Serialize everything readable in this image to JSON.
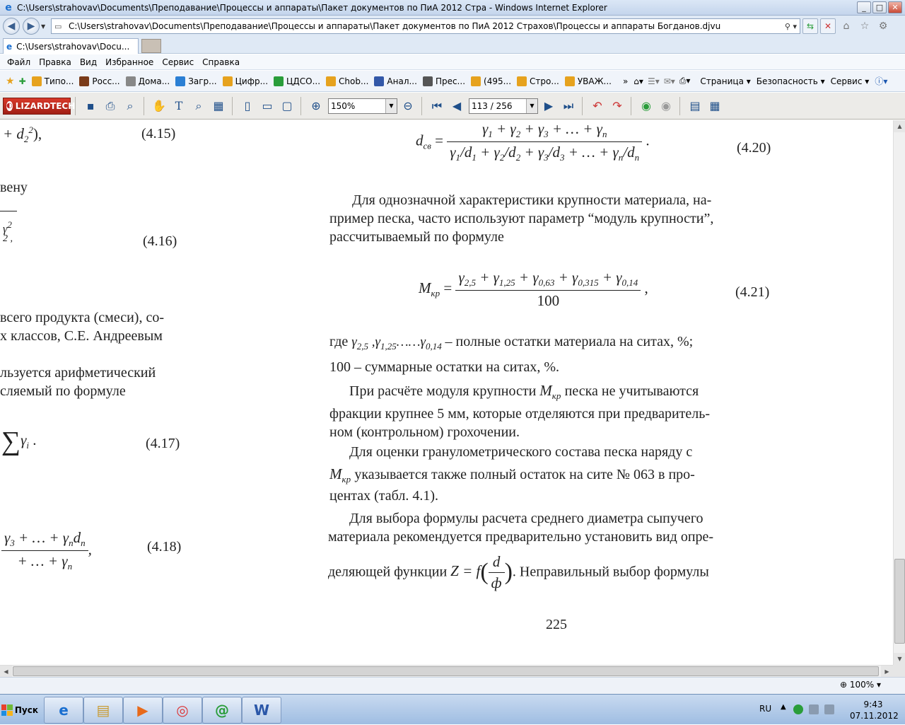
{
  "window": {
    "title": "C:\\Users\\strahovav\\Documents\\Преподавание\\Процессы и аппараты\\Пакет документов по ПиА 2012 Стра - Windows Internet Explorer",
    "buttons": {
      "minimize": "_",
      "maximize": "□",
      "close": "✕"
    }
  },
  "address": {
    "url": "C:\\Users\\strahovav\\Documents\\Преподавание\\Процессы и аппараты\\Пакет документов по ПиА 2012 Страхов\\Процессы и аппараты Богданов.djvu"
  },
  "tab": {
    "label": "C:\\Users\\strahovav\\Docu..."
  },
  "menu": [
    "Файл",
    "Правка",
    "Вид",
    "Избранное",
    "Сервис",
    "Справка"
  ],
  "favorites": [
    {
      "label": "Типо...",
      "color": "#e6a21e"
    },
    {
      "label": "Росс...",
      "color": "#7a3b1a"
    },
    {
      "label": "Дома...",
      "color": "#888888"
    },
    {
      "label": "Загр...",
      "color": "#2b7fd4"
    },
    {
      "label": "Цифр...",
      "color": "#e6a21e"
    },
    {
      "label": "ЦДСО...",
      "color": "#2a9d3a"
    },
    {
      "label": "Chob...",
      "color": "#e6a21e"
    },
    {
      "label": "Анал...",
      "color": "#3358a8"
    },
    {
      "label": "Прес...",
      "color": "#555555"
    },
    {
      "label": "(495...",
      "color": "#e6a21e"
    },
    {
      "label": "Стро...",
      "color": "#e6a21e"
    },
    {
      "label": "УВАЖ...",
      "color": "#e6a21e"
    }
  ],
  "commands": {
    "page": "Страница",
    "security": "Безопасность",
    "service": "Сервис"
  },
  "djvu": {
    "logo": "LIZARDTECH",
    "zoom": "150%",
    "page": "113 / 256"
  },
  "document": {
    "left_fragments": {
      "eq_415_tail": "+ d",
      "eq_415_no": "(4.15)",
      "word_venu": "вену",
      "eq_416_no": "(4.16)",
      "line1": "всего продукта (смеси), со-",
      "line2": "х классов, С.Е. Андреевым",
      "line3": "льзуется   арифметический",
      "line4": "сляемый по формуле",
      "eq_417_no": "(4.17)",
      "eq_418_no": "(4.18)"
    },
    "eq_420": {
      "lhs": "d",
      "lhs_sub": "св",
      "number": "(4.20)"
    },
    "para1": [
      "Для однозначной характеристики крупности материала, на-",
      "пример песка, часто используют параметр “модуль крупности”,",
      "рассчитываемый по формуле"
    ],
    "eq_421": {
      "lhs": "M",
      "lhs_sub": "кр",
      "denominator": "100",
      "number": "(4.21)"
    },
    "where": {
      "prefix": "где",
      "suffix": "– полные остатки материала на ситах, %;",
      "line2": "100 – суммарные остатки на ситах, %."
    },
    "para2": [
      "При расчёте модуля крупности",
      "песка не учитываются",
      "фракции крупнее 5 мм, которые отделяются при предваритель-",
      "ном (контрольном) грохочении."
    ],
    "para3": [
      "Для оценки гранулометрического состава песка наряду с",
      "указывается также полный остаток на сите № 063 в про-",
      "центах (табл. 4.1)."
    ],
    "para4": [
      "Для выбора формулы расчета среднего диаметра сыпучего",
      "материала рекомендуется предварительно установить вид опре-",
      "деляющей функции",
      ". Неправильный выбор формулы"
    ],
    "page_number": "225"
  },
  "status": {
    "zoom": "100%"
  },
  "taskbar": {
    "start": "Пуск",
    "lang": "RU",
    "time": "9:43",
    "date": "07.11.2012"
  }
}
